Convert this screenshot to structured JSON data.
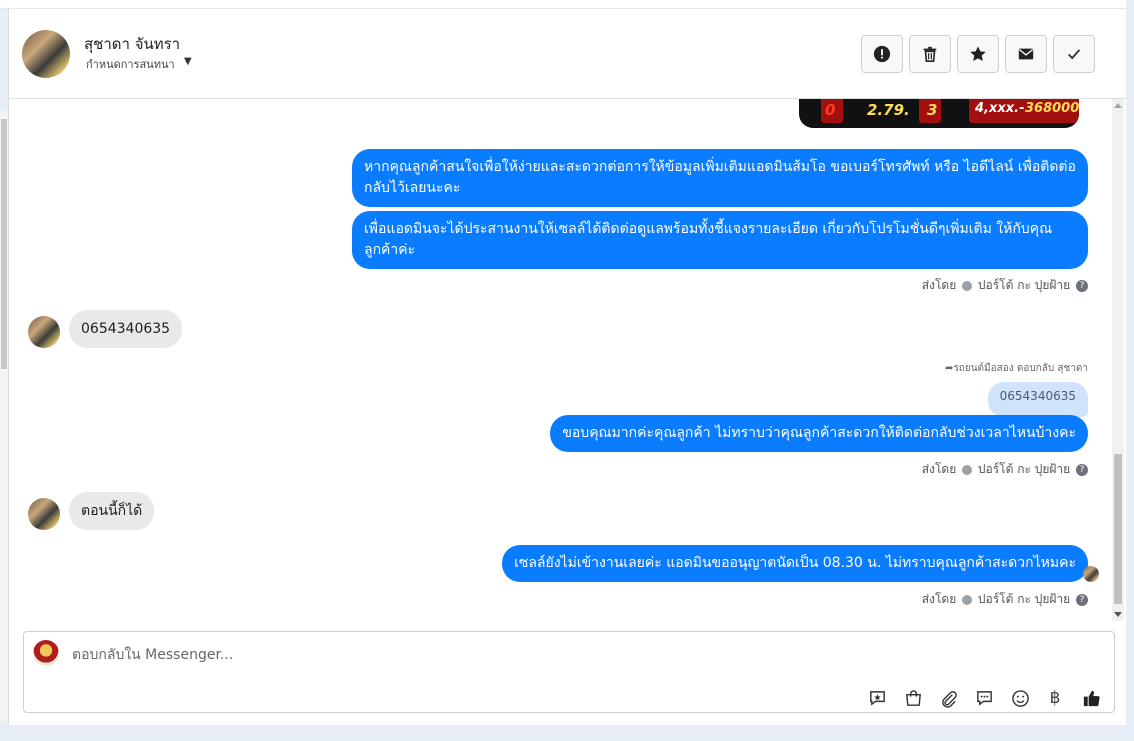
{
  "header": {
    "contact_name": "สุชาดา จันทรา",
    "assign_label": "กำหนดการสนทนา",
    "actions": [
      "spam-icon",
      "trash-icon",
      "star-icon",
      "envelope-icon",
      "check-icon"
    ]
  },
  "preview_image": {
    "numbers": [
      "0",
      "2.79.",
      "3",
      "4,xxx.-",
      "368000"
    ]
  },
  "messages": {
    "out_1": "หากคุณลูกค้าสนใจเพื่อให้ง่ายและสะดวกต่อการให้ข้อมูลเพิ่มเติมแอดมินส้มโอ ขอเบอร์โทรศัพท์ หรือ ไอดีไลน์ เพื่อติดต่อกลับไว้เลยนะคะ",
    "out_2": "เพื่อแอดมินจะได้ประสานงานให้เซลล์ได้ติดต่อดูแลพร้อมทั้งชี้แจงรายละเอียด เกี่ยวกับโปรโมชั่นดีๆเพิ่มเติม ให้กับคุณลูกค้าค่ะ",
    "in_1": "0654340635",
    "reply_note": "รถยนต์มือสอง ตอบกลับ สุชาดา",
    "quoted": "0654340635",
    "out_3": "ขอบคุณมากค่ะคุณลูกค้า ไม่ทราบว่าคุณลูกค้าสะดวกให้ติดต่อกลับช่วงเวลาไหนบ้างคะ",
    "in_2": "ตอนนี้ก็ได้",
    "out_4": "เซลล์ยังไม่เข้างานเลยค่ะ แอดมินขออนุญาตนัดเป็น 08.30 น. ไม่ทราบคุณลูกค้าสะดวกไหมคะ"
  },
  "sent_by": {
    "prefix": "ส่งโดย",
    "agent": "ปอร์โต้ กะ ปุยฝ้าย"
  },
  "composer": {
    "placeholder": "ตอบกลับใน Messenger...",
    "tools": [
      "saved-reply-icon",
      "shopping-bag-icon",
      "attachment-icon",
      "chat-bubble-icon",
      "emoji-icon",
      "baht-icon",
      "thumbs-up-icon"
    ],
    "baht_symbol": "฿"
  },
  "colors": {
    "outgoing_bubble": "#0a7cff",
    "incoming_bubble": "#e9e9eb",
    "quoted_bubble": "#cfe3fb"
  }
}
